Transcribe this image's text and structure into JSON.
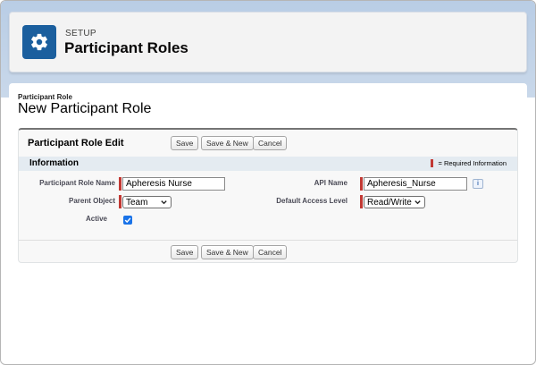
{
  "header": {
    "section_label": "SETUP",
    "title": "Participant Roles",
    "icon": "gear-icon",
    "icon_color": "#1b5f9e"
  },
  "page": {
    "eyebrow": "Participant Role",
    "title": "New Participant Role"
  },
  "edit_block": {
    "title": "Participant Role Edit",
    "buttons": {
      "save": "Save",
      "save_new": "Save & New",
      "cancel": "Cancel"
    }
  },
  "information": {
    "title": "Information",
    "required_legend": "= Required Information",
    "required_color": "#c23934"
  },
  "fields": {
    "role_name": {
      "label": "Participant Role Name",
      "value": "Apheresis Nurse"
    },
    "api_name": {
      "label": "API Name",
      "value": "Apheresis_Nurse"
    },
    "parent_object": {
      "label": "Parent Object",
      "value": "Team"
    },
    "default_access": {
      "label": "Default Access Level",
      "value": "Read/Write"
    },
    "active": {
      "label": "Active",
      "checked": true
    }
  }
}
